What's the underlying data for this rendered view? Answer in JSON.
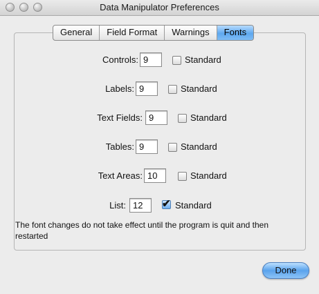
{
  "window": {
    "title": "Data Manipulator Preferences"
  },
  "tabs": [
    {
      "label": "General",
      "active": false
    },
    {
      "label": "Field Format",
      "active": false
    },
    {
      "label": "Warnings",
      "active": false
    },
    {
      "label": "Fonts",
      "active": true
    }
  ],
  "fonts": {
    "rows": [
      {
        "label": "Controls:",
        "value": "9",
        "standard_label": "Standard",
        "standard_checked": false
      },
      {
        "label": "Labels:",
        "value": "9",
        "standard_label": "Standard",
        "standard_checked": false
      },
      {
        "label": "Text Fields:",
        "value": "9",
        "standard_label": "Standard",
        "standard_checked": false
      },
      {
        "label": "Tables:",
        "value": "9",
        "standard_label": "Standard",
        "standard_checked": false
      },
      {
        "label": "Text Areas:",
        "value": "10",
        "standard_label": "Standard",
        "standard_checked": false
      },
      {
        "label": "List:",
        "value": "12",
        "standard_label": "Standard",
        "standard_checked": true
      }
    ],
    "note": "The font changes do not take effect until the program is quit and then restarted"
  },
  "buttons": {
    "done_label": "Done"
  },
  "colors": {
    "accent": "#5ea8ef"
  }
}
